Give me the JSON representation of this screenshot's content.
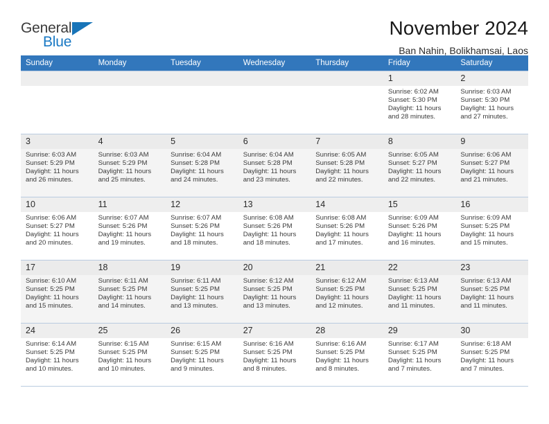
{
  "brand": {
    "name_part1": "General",
    "name_part2": "Blue",
    "accent_color": "#1878c4",
    "triangle_color": "#1874b8"
  },
  "header": {
    "title": "November 2024",
    "subtitle": "Ban Nahin, Bolikhamsai, Laos"
  },
  "calendar": {
    "header_color": "#3277bc",
    "weekdays": [
      "Sunday",
      "Monday",
      "Tuesday",
      "Wednesday",
      "Thursday",
      "Friday",
      "Saturday"
    ],
    "weeks": [
      [
        {
          "day": "",
          "sunrise": "",
          "sunset": "",
          "daylight": "",
          "empty": true
        },
        {
          "day": "",
          "sunrise": "",
          "sunset": "",
          "daylight": "",
          "empty": true
        },
        {
          "day": "",
          "sunrise": "",
          "sunset": "",
          "daylight": "",
          "empty": true
        },
        {
          "day": "",
          "sunrise": "",
          "sunset": "",
          "daylight": "",
          "empty": true
        },
        {
          "day": "",
          "sunrise": "",
          "sunset": "",
          "daylight": "",
          "empty": true
        },
        {
          "day": "1",
          "sunrise": "Sunrise: 6:02 AM",
          "sunset": "Sunset: 5:30 PM",
          "daylight": "Daylight: 11 hours and 28 minutes."
        },
        {
          "day": "2",
          "sunrise": "Sunrise: 6:03 AM",
          "sunset": "Sunset: 5:30 PM",
          "daylight": "Daylight: 11 hours and 27 minutes."
        }
      ],
      [
        {
          "day": "3",
          "sunrise": "Sunrise: 6:03 AM",
          "sunset": "Sunset: 5:29 PM",
          "daylight": "Daylight: 11 hours and 26 minutes."
        },
        {
          "day": "4",
          "sunrise": "Sunrise: 6:03 AM",
          "sunset": "Sunset: 5:29 PM",
          "daylight": "Daylight: 11 hours and 25 minutes."
        },
        {
          "day": "5",
          "sunrise": "Sunrise: 6:04 AM",
          "sunset": "Sunset: 5:28 PM",
          "daylight": "Daylight: 11 hours and 24 minutes."
        },
        {
          "day": "6",
          "sunrise": "Sunrise: 6:04 AM",
          "sunset": "Sunset: 5:28 PM",
          "daylight": "Daylight: 11 hours and 23 minutes."
        },
        {
          "day": "7",
          "sunrise": "Sunrise: 6:05 AM",
          "sunset": "Sunset: 5:28 PM",
          "daylight": "Daylight: 11 hours and 22 minutes."
        },
        {
          "day": "8",
          "sunrise": "Sunrise: 6:05 AM",
          "sunset": "Sunset: 5:27 PM",
          "daylight": "Daylight: 11 hours and 22 minutes."
        },
        {
          "day": "9",
          "sunrise": "Sunrise: 6:06 AM",
          "sunset": "Sunset: 5:27 PM",
          "daylight": "Daylight: 11 hours and 21 minutes."
        }
      ],
      [
        {
          "day": "10",
          "sunrise": "Sunrise: 6:06 AM",
          "sunset": "Sunset: 5:27 PM",
          "daylight": "Daylight: 11 hours and 20 minutes."
        },
        {
          "day": "11",
          "sunrise": "Sunrise: 6:07 AM",
          "sunset": "Sunset: 5:26 PM",
          "daylight": "Daylight: 11 hours and 19 minutes."
        },
        {
          "day": "12",
          "sunrise": "Sunrise: 6:07 AM",
          "sunset": "Sunset: 5:26 PM",
          "daylight": "Daylight: 11 hours and 18 minutes."
        },
        {
          "day": "13",
          "sunrise": "Sunrise: 6:08 AM",
          "sunset": "Sunset: 5:26 PM",
          "daylight": "Daylight: 11 hours and 18 minutes."
        },
        {
          "day": "14",
          "sunrise": "Sunrise: 6:08 AM",
          "sunset": "Sunset: 5:26 PM",
          "daylight": "Daylight: 11 hours and 17 minutes."
        },
        {
          "day": "15",
          "sunrise": "Sunrise: 6:09 AM",
          "sunset": "Sunset: 5:26 PM",
          "daylight": "Daylight: 11 hours and 16 minutes."
        },
        {
          "day": "16",
          "sunrise": "Sunrise: 6:09 AM",
          "sunset": "Sunset: 5:25 PM",
          "daylight": "Daylight: 11 hours and 15 minutes."
        }
      ],
      [
        {
          "day": "17",
          "sunrise": "Sunrise: 6:10 AM",
          "sunset": "Sunset: 5:25 PM",
          "daylight": "Daylight: 11 hours and 15 minutes."
        },
        {
          "day": "18",
          "sunrise": "Sunrise: 6:11 AM",
          "sunset": "Sunset: 5:25 PM",
          "daylight": "Daylight: 11 hours and 14 minutes."
        },
        {
          "day": "19",
          "sunrise": "Sunrise: 6:11 AM",
          "sunset": "Sunset: 5:25 PM",
          "daylight": "Daylight: 11 hours and 13 minutes."
        },
        {
          "day": "20",
          "sunrise": "Sunrise: 6:12 AM",
          "sunset": "Sunset: 5:25 PM",
          "daylight": "Daylight: 11 hours and 13 minutes."
        },
        {
          "day": "21",
          "sunrise": "Sunrise: 6:12 AM",
          "sunset": "Sunset: 5:25 PM",
          "daylight": "Daylight: 11 hours and 12 minutes."
        },
        {
          "day": "22",
          "sunrise": "Sunrise: 6:13 AM",
          "sunset": "Sunset: 5:25 PM",
          "daylight": "Daylight: 11 hours and 11 minutes."
        },
        {
          "day": "23",
          "sunrise": "Sunrise: 6:13 AM",
          "sunset": "Sunset: 5:25 PM",
          "daylight": "Daylight: 11 hours and 11 minutes."
        }
      ],
      [
        {
          "day": "24",
          "sunrise": "Sunrise: 6:14 AM",
          "sunset": "Sunset: 5:25 PM",
          "daylight": "Daylight: 11 hours and 10 minutes."
        },
        {
          "day": "25",
          "sunrise": "Sunrise: 6:15 AM",
          "sunset": "Sunset: 5:25 PM",
          "daylight": "Daylight: 11 hours and 10 minutes."
        },
        {
          "day": "26",
          "sunrise": "Sunrise: 6:15 AM",
          "sunset": "Sunset: 5:25 PM",
          "daylight": "Daylight: 11 hours and 9 minutes."
        },
        {
          "day": "27",
          "sunrise": "Sunrise: 6:16 AM",
          "sunset": "Sunset: 5:25 PM",
          "daylight": "Daylight: 11 hours and 8 minutes."
        },
        {
          "day": "28",
          "sunrise": "Sunrise: 6:16 AM",
          "sunset": "Sunset: 5:25 PM",
          "daylight": "Daylight: 11 hours and 8 minutes."
        },
        {
          "day": "29",
          "sunrise": "Sunrise: 6:17 AM",
          "sunset": "Sunset: 5:25 PM",
          "daylight": "Daylight: 11 hours and 7 minutes."
        },
        {
          "day": "30",
          "sunrise": "Sunrise: 6:18 AM",
          "sunset": "Sunset: 5:25 PM",
          "daylight": "Daylight: 11 hours and 7 minutes."
        }
      ]
    ]
  }
}
